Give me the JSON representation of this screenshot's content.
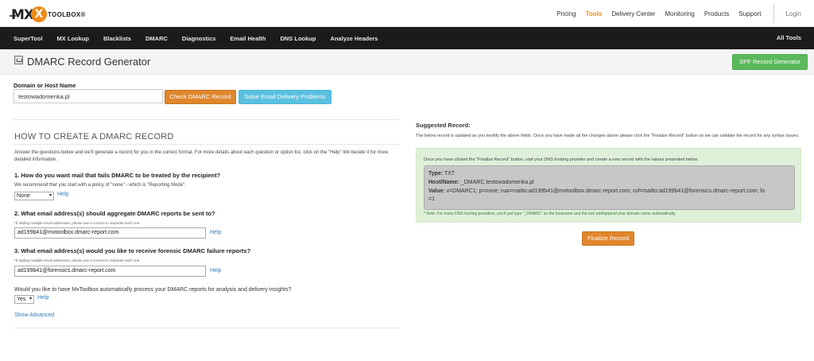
{
  "brand": {
    "mx": "MX",
    "x": "X",
    "toolbox": "TOOLBOX",
    "reg": "®",
    "accent": "#ef8a17"
  },
  "topnav": {
    "pricing": "Pricing",
    "tools": "Tools",
    "delivery": "Delivery Center",
    "monitoring": "Monitoring",
    "products": "Products",
    "support": "Support",
    "login": "Login"
  },
  "darknav": {
    "items": [
      "SuperTool",
      "MX Lookup",
      "Blacklists",
      "DMARC",
      "Diagnostics",
      "Email Health",
      "DNS Lookup",
      "Analyze Headers"
    ],
    "all_tools": "All Tools"
  },
  "page": {
    "title": "DMARC Record Generator",
    "spf_button": "SPF Record Generator"
  },
  "domain": {
    "label": "Domain or Host Name",
    "value": "testowadomenka.pl",
    "check_button": "Check DMARC Record",
    "solve_button": "Solve Email Delivery Problems"
  },
  "howto": {
    "title": "HOW TO CREATE A DMARC RECORD",
    "intro": "Answer the questions below and we'll generate a record for you in the correct format. For more details about each question or option list, click on the \"Help\" link beside it for more detailed information.",
    "q1": "1. How do you want mail that fails DMARC to be treated by the recipient?",
    "q1_note": "We recommend that you start with a policy of \"none\" - which is \"Reporting Mode\".",
    "q1_value": "None",
    "q2": "2. What email address(s) should aggregate DMARC reports be sent to?",
    "q2_note": "*If adding multiple email addresses, please use a comma to separate each one.",
    "q2_value": "ad199b41@mxtoolbox.dmarc-report.com",
    "q3": "3. What email address(s) would you like to receive forensic DMARC failure reports?",
    "q3_note": "*If adding multiple email addresses, please use a comma to separate each one.",
    "q3_value": "ad199b41@forensics.dmarc-report.com",
    "q4": "Would you like to have MxToolbox automatically process your DMARC reports for analysis and delivery insights?",
    "q4_value": "Yes",
    "help": "Help",
    "show_advanced": "Show Advanced"
  },
  "suggested": {
    "label": "Suggested Record:",
    "desc": "The below record is updated as you modify the above fields. Once you have made all the changes above please click the \"Finalize Record\" button so we can validate the record for any syntax issues.",
    "instruction": "Once you have clicked the \"Finalize Record\" button, visit your DNS hosting provider and create a new record with the values presented below.",
    "type_label": "Type:",
    "type_value": "TXT",
    "host_label": "Host/Name:",
    "host_value": "_DMARC.testowadomenka.pl",
    "value_label": "Value:",
    "value_line1": "v=DMARC1; p=none; rua=mailto:ad199b41@mxtoolbox.dmarc-report.com; ruf=mailto:ad199b41@forensics.dmarc-report.com; fo",
    "value_line2": "=1",
    "footnote": "* Note: For many DNS hosting providers, you'll just type \"_DMARC\" as the hostname and the tool add/append your domain name automatically.",
    "finalize_button": "Finalize Record"
  }
}
